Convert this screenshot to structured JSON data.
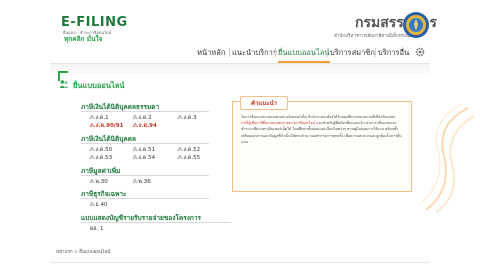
{
  "header": {
    "logo_text": "E-FILING",
    "logo_sub": "ยื่นแบบ - ชำระภาษีออนไลน์",
    "logo_tagline": "ทุกคลิก มั่นใจ",
    "org_title": "กรมสรรพากร",
    "org_subtitle": "สำนักบริหารการเสียภาษีทางอิเล็กทรอนิกส์"
  },
  "nav": {
    "items": [
      {
        "label": "หน้าหลัก"
      },
      {
        "label": "แนะนำบริการ"
      },
      {
        "label": "ยื่นแบบออนไลน์",
        "active": true
      },
      {
        "label": "บริการสมาชิก"
      },
      {
        "label": "บริการอื่น"
      }
    ],
    "settings_icon": "gear-icon"
  },
  "page": {
    "title": "ยื่นแบบออนไลน์",
    "sections": [
      {
        "title": "ภาษีเงินได้นิติบุคคลธรรมดา",
        "forms": [
          "ภ.ง.ด.1",
          "ภ.ง.ด.2",
          "ภ.ง.ด.3",
          "ภ.ง.ด.90/91",
          "ภ.ง.ด.94"
        ]
      },
      {
        "title": "ภาษีเงินได้นิติบุคคล",
        "forms": [
          "ภ.ง.ด.50",
          "ภ.ง.ด.51",
          "ภ.ง.ด.52",
          "ภ.ง.ด.53",
          "ภ.ง.ด.54",
          "ภ.ง.ด.55"
        ]
      },
      {
        "title": "ภาษีมูลค่าเพิ่ม",
        "forms": [
          "ภ.พ.30",
          "ภ.พ.36"
        ]
      },
      {
        "title": "ภาษีธุรกิจเฉพาะ",
        "forms": [
          "ภ.ธ.40"
        ]
      },
      {
        "title": "แบบแสดงบัญชีรายรับรายจ่ายของโครงการ",
        "forms": [
          "ผอ. 1"
        ]
      }
    ],
    "highlighted_forms": [
      "ภ.ง.ด.90/91",
      "ภ.ง.ด.94"
    ]
  },
  "notice": {
    "heading": "คำแนะนำ",
    "text_before": "ในการยื่นแบบบางแบบผ่านทางอินเทอร์เน็ต สำนักงานจะต้องได้รับอนุมัติจากหน่วยงานที่เกี่ยวข้องก่อน ",
    "text_red": "กรณีผู้เสียภาษียื่นแบบแสดงรายการภาษีออนไลน์",
    "text_after": " และสำหรับผู้ที่สมัครยื่นแบบแล้ว สามารถยื่นแบบและชำระภาษีผ่านทางอินเทอร์เน็ตได้ โดยศึกษาขั้นตอนและเงื่อนไขต่างๆ ตามคู่มือก่อนการใช้งาน พร้อมทั้งเตรียมเอกสารและข้อมูลที่จำเป็นให้ครบถ้วน ก่อนทำรายการทุกครั้ง เพื่อความสะดวกและถูกต้องในการยื่นแบบ"
  },
  "breadcrumb": "หน้าแรก > ยื่นแบบออนไลน์",
  "colors": {
    "brand_green": "#2aa24a",
    "dark_green": "#1d7a3a",
    "accent_orange": "#f0a02c",
    "alert_red": "#c0392b"
  }
}
